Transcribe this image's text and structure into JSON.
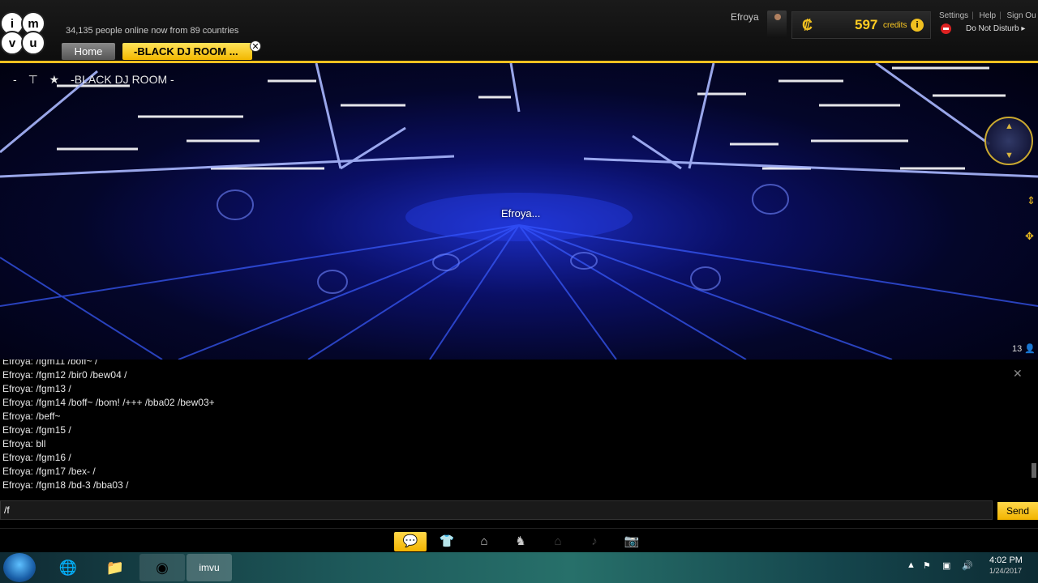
{
  "header": {
    "logo_text": [
      "i",
      "m",
      "v",
      "u"
    ],
    "online_text": "34,135 people online now from 89 countries",
    "home_tab": "Home",
    "room_tab": "-BLACK DJ ROOM ...",
    "username": "Efroya",
    "credits_amount": "597",
    "credits_label": "credits",
    "links": [
      "Settings",
      "Help",
      "Sign Ou"
    ],
    "status": "Do Not Disturb"
  },
  "scene": {
    "room_title": "-BLACK DJ ROOM -",
    "avatar_label": "Efroya...",
    "occupancy": "13"
  },
  "chat": {
    "lines": [
      "Efroya: /fgm11 /boff~ /",
      "Efroya: /fgm12 /bir0 /bew04 /",
      "Efroya: /fgm13 /",
      "Efroya: /fgm14 /boff~ /bom! /+++ /bba02 /bew03+",
      "Efroya: /beff~",
      "Efroya: /fgm15 /",
      "Efroya: bll",
      "Efroya: /fgm16 /",
      "Efroya: /fgm17 /bex- /",
      "Efroya: /fgm18 /bd-3 /bba03 /"
    ],
    "input_value": "/f",
    "send_label": "Send"
  },
  "toolbar": {
    "items": [
      "chat-icon",
      "outfit-icon",
      "hanger-icon",
      "pose-icon",
      "home-icon",
      "music-icon",
      "camera-icon"
    ]
  },
  "taskbar": {
    "time": "4:02 PM",
    "date": "1/24/2017"
  },
  "colors": {
    "accent": "#f0c020",
    "scene_blue": "#1b2cc0",
    "dnd_red": "#d22222"
  }
}
